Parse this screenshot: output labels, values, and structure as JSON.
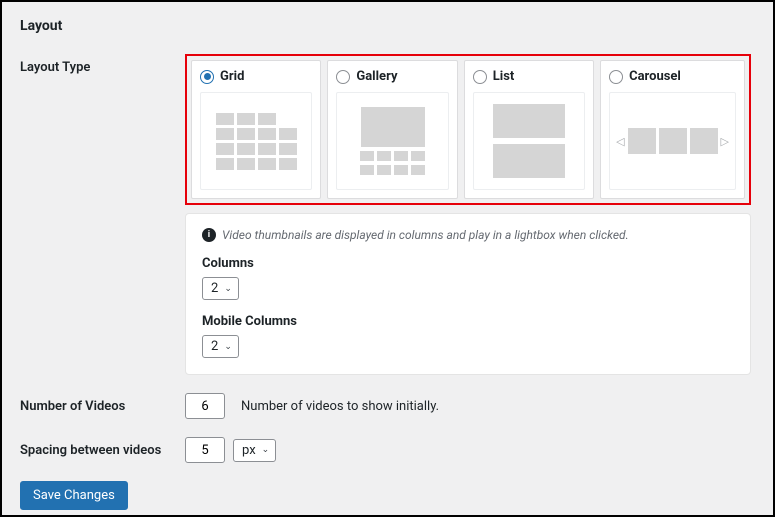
{
  "section_title": "Layout",
  "layout_type": {
    "label": "Layout Type",
    "selected": "grid",
    "options": {
      "grid": "Grid",
      "gallery": "Gallery",
      "list": "List",
      "carousel": "Carousel"
    }
  },
  "settings": {
    "info_text": "Video thumbnails are displayed in columns and play in a lightbox when clicked.",
    "columns": {
      "label": "Columns",
      "value": "2"
    },
    "mobile_columns": {
      "label": "Mobile Columns",
      "value": "2"
    }
  },
  "number_of_videos": {
    "label": "Number of Videos",
    "value": "6",
    "help": "Number of videos to show initially."
  },
  "spacing": {
    "label": "Spacing between videos",
    "value": "5",
    "unit": "px"
  },
  "save_button": "Save Changes"
}
